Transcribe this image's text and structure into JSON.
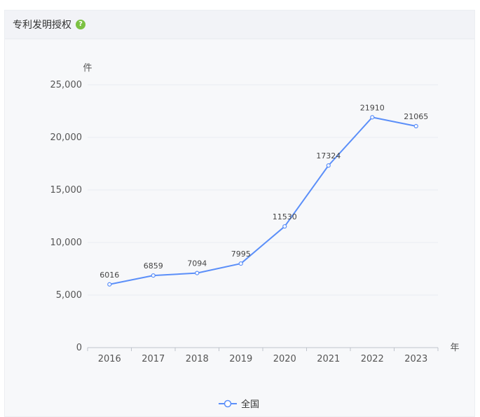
{
  "panel": {
    "title": "专利发明授权",
    "help_icon": "question-circle-icon"
  },
  "colors": {
    "line": "#5b8ff9",
    "grid": "#e9ecf2",
    "axis": "#bfc4cc"
  },
  "chart_data": {
    "type": "line",
    "title": "",
    "ylabel": "件",
    "xlabel": "年",
    "ylim": [
      0,
      25000
    ],
    "yticks": [
      "0",
      "5,000",
      "10,000",
      "15,000",
      "20,000",
      "25,000"
    ],
    "ytick_values": [
      0,
      5000,
      10000,
      15000,
      20000,
      25000
    ],
    "categories": [
      "2016",
      "2017",
      "2018",
      "2019",
      "2020",
      "2021",
      "2022",
      "2023"
    ],
    "series": [
      {
        "name": "全国",
        "values": [
          6016,
          6859,
          7094,
          7995,
          11530,
          17324,
          21910,
          21065
        ]
      }
    ],
    "legend_position": "bottom-center",
    "grid": true
  }
}
